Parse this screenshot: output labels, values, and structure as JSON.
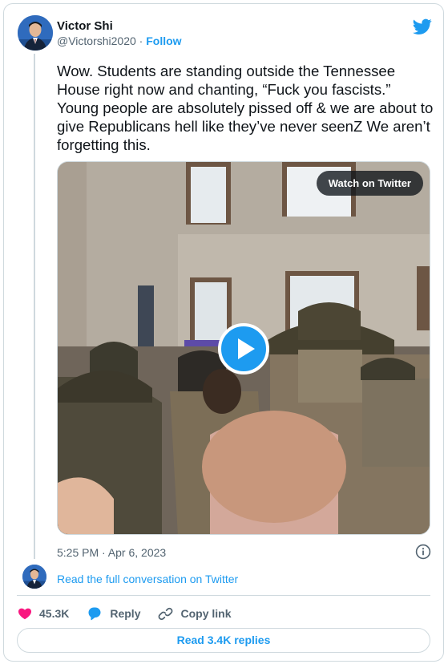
{
  "tweet": {
    "author_name": "Victor Shi",
    "author_handle": "@Victorshi2020",
    "separator": " · ",
    "follow_label": "Follow",
    "text": "Wow. Students are standing outside the Tennessee House right now and chanting, “Fuck you fascists.” Young people are absolutely pissed off & we are about to give Republicans hell like they’ve never seenZ We aren’t forgetting this.",
    "timestamp": "5:25 PM · Apr 6, 2023"
  },
  "media": {
    "watch_label": "Watch on Twitter"
  },
  "conversation": {
    "read_full_label": "Read the full conversation on Twitter"
  },
  "actions": {
    "like_count": "45.3K",
    "reply_label": "Reply",
    "copy_label": "Copy link"
  },
  "footer": {
    "read_replies_label": "Read 3.4K replies"
  },
  "colors": {
    "accent": "#1d9bf0",
    "like": "#f91880",
    "text_secondary": "#536471",
    "border": "#cfd9de"
  },
  "icons": [
    "twitter-bird-icon",
    "play-icon",
    "info-icon",
    "heart-icon",
    "reply-icon",
    "link-icon"
  ]
}
